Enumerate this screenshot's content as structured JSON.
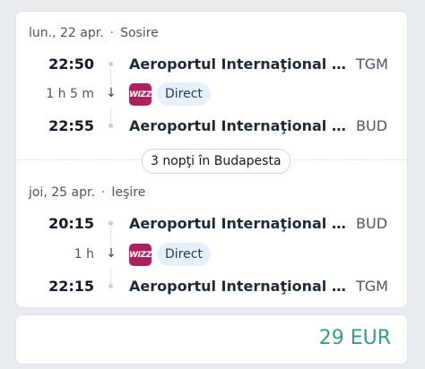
{
  "outbound": {
    "date": "lun., 22 apr.",
    "label": "Sosire",
    "depart_time": "22:50",
    "depart_airport": "Aeroportul Internaţional Tran...",
    "depart_code": "TGM",
    "duration": "1 h 5 m",
    "carrier_logo": "wizz",
    "stops": "Direct",
    "arrive_time": "22:55",
    "arrive_airport": "Aeroportul Internaţional Budap...",
    "arrive_code": "BUD"
  },
  "stay": "3 nopţi în Budapesta",
  "return": {
    "date": "joi, 25 apr.",
    "label": "Ieşire",
    "depart_time": "20:15",
    "depart_airport": "Aeroportul Internaţional Budap...",
    "depart_code": "BUD",
    "duration": "1 h",
    "carrier_logo": "wizz",
    "stops": "Direct",
    "arrive_time": "22:15",
    "arrive_airport": "Aeroportul Internaţional Tran...",
    "arrive_code": "TGM"
  },
  "price": "29 EUR",
  "colors": {
    "price": "#3a9a8a",
    "carrier": "#a8235f",
    "badge_bg": "#e6f0fa"
  }
}
